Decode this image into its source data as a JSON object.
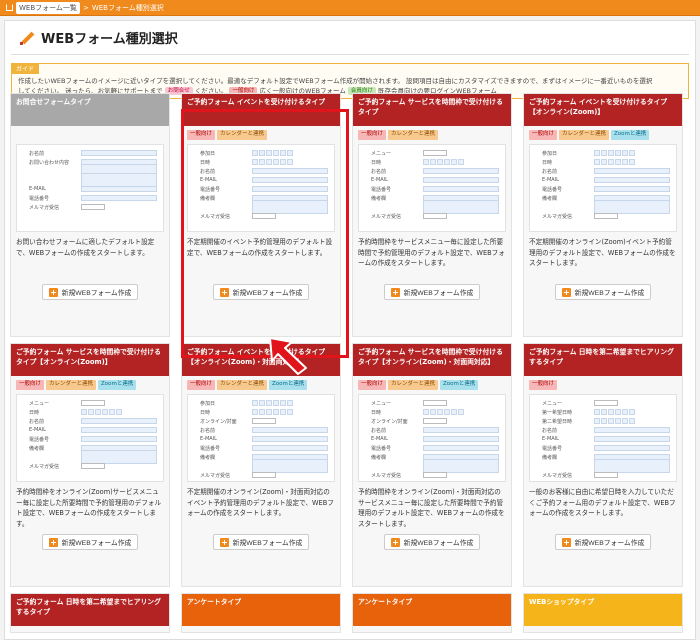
{
  "breadcrumb": {
    "home": "WEBフォーム一覧",
    "sep": ">",
    "current": "WEBフォーム種別選択"
  },
  "page": {
    "title": "WEBフォーム種別選択"
  },
  "guide": {
    "tag": "ガイド",
    "line1": "作成したいWEBフォームのイメージに近いタイプを選択してください。最適なデフォルト設定でWEBフォーム作成が開始されます。 設問項目は自由にカスタマイズできますので、まずはイメージに一番近いものを選択",
    "line2a": "してください。 迷ったら、お気軽にサポートまで",
    "mail_badge": "お問合せ",
    "line2b": "ください。",
    "general_badge": "一般向け",
    "line2c": "広く一般向けのWEBフォーム",
    "member_badge": "会員向け",
    "line2d": "既存会員向けの要ログインWEBフォーム"
  },
  "new_button_label": "新規WEBフォーム作成",
  "colors": {
    "accent": "#f08a1c",
    "card_red": "#b32323",
    "card_gray": "#a8a8a8",
    "highlight": "#e0141a"
  },
  "cards": [
    {
      "title": "お問合せフォームタイプ",
      "tags": [],
      "fields": [
        "お名前",
        "お問い合わせ内容",
        "",
        "",
        "E-MAIL",
        "電話番号",
        "メルマガ受信"
      ],
      "desc": "お問い合わせフォームに適したデフォルト設定で、WEBフォームの作成をスタートします。"
    },
    {
      "title": "ご予約フォーム イベントを受け付けるタイプ",
      "tags": [
        "一般向け",
        "カレンダーと連携"
      ],
      "fields": [
        "参加日",
        "日時",
        "お名前",
        "E-MAIL",
        "電話番号",
        "備考欄",
        "",
        "メルマガ受信"
      ],
      "desc": "不定期開催のイベント予約管理用のデフォルト設定で、WEBフォームの作成をスタートします。"
    },
    {
      "title": "ご予約フォーム サービスを時間枠で受け付けるタイプ",
      "tags": [
        "一般向け",
        "カレンダーと連携"
      ],
      "fields": [
        "メニュー",
        "日時",
        "お名前",
        "E-MAIL",
        "電話番号",
        "備考欄",
        "",
        "メルマガ受信"
      ],
      "desc": "予約時間枠をサービスメニュー毎に設定した所要時間で予約管理用のデフォルト設定で、WEBフォームの作成をスタートします。"
    },
    {
      "title": "ご予約フォーム イベントを受け付けるタイプ【オンライン(Zoom)】",
      "tags": [
        "一般向け",
        "カレンダーと連携",
        "Zoomと連携"
      ],
      "fields": [
        "参加日",
        "日時",
        "お名前",
        "E-MAIL",
        "電話番号",
        "備考欄",
        "",
        "メルマガ受信"
      ],
      "desc": "不定期開催のオンライン(Zoom)イベント予約管理用のデフォルト設定で、WEBフォームの作成をスタートします。"
    },
    {
      "title": "ご予約フォーム サービスを時間枠で受け付けるタイプ【オンライン(Zoom)】",
      "tags": [
        "一般向け",
        "カレンダーと連携",
        "Zoomと連携"
      ],
      "fields": [
        "メニュー",
        "日時",
        "お名前",
        "E-MAIL",
        "電話番号",
        "備考欄",
        "",
        "メルマガ受信"
      ],
      "desc": "予約時間枠をオンライン(Zoom)サービスメニュー毎に設定した所要時間で予約管理用のデフォルト設定で、WEBフォームの作成をスタートします。"
    },
    {
      "title": "ご予約フォーム イベントを受け付けるタイプ【オンライン(Zoom)・対面両対応】",
      "tags": [
        "一般向け",
        "カレンダーと連携",
        "Zoomと連携"
      ],
      "fields": [
        "参加日",
        "日時",
        "オンライン/対面",
        "お名前",
        "E-MAIL",
        "電話番号",
        "備考欄",
        "",
        "メルマガ受信"
      ],
      "desc": "不定期開催のオンライン(Zoom)・対面両対応のイベント予約管理用のデフォルト設定で、WEBフォームの作成をスタートします。"
    },
    {
      "title": "ご予約フォーム サービスを時間枠で受け付けるタイプ【オンライン(Zoom)・対面両対応】",
      "tags": [
        "一般向け",
        "カレンダーと連携",
        "Zoomと連携"
      ],
      "fields": [
        "メニュー",
        "日時",
        "オンライン/対面",
        "お名前",
        "E-MAIL",
        "電話番号",
        "備考欄",
        "",
        "メルマガ受信"
      ],
      "desc": "予約時間枠をオンライン(Zoom)・対面両対応のサービスメニュー毎に設定した所要時間で予約管理用のデフォルト設定で、WEBフォームの作成をスタートします。"
    },
    {
      "title": "ご予約フォーム 日時を第二希望までヒアリングするタイプ",
      "tags": [
        "一般向け"
      ],
      "fields": [
        "メニュー",
        "第一希望日時",
        "第二希望日時",
        "お名前",
        "E-MAIL",
        "電話番号",
        "備考欄",
        "",
        "メルマガ受信"
      ],
      "desc": "一般のお客様に自由に希望日時を入力していただくご予約フォーム用のデフォルト設定で、WEBフォームの作成をスタートします。"
    },
    {
      "title": "ご予約フォーム 日時を第二希望までヒアリングするタイプ"
    },
    {
      "title": "アンケートタイプ"
    },
    {
      "title": "アンケートタイプ"
    },
    {
      "title": "WEBショップタイプ"
    }
  ]
}
